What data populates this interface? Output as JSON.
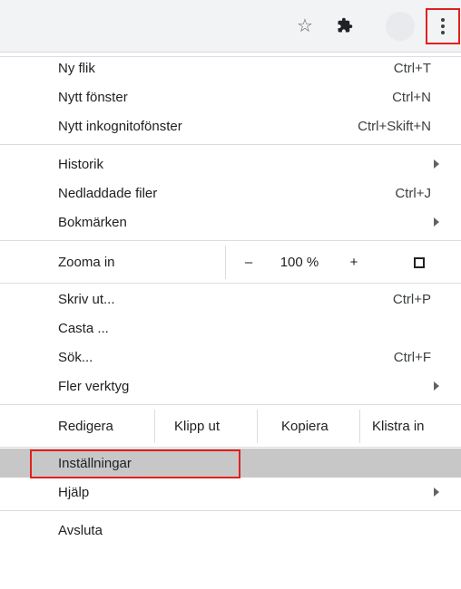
{
  "toolbar": {
    "star_icon": "star-icon",
    "extensions_icon": "puzzle-icon",
    "menu_icon": "three-dot-menu-icon",
    "highlight_color": "#e0211e"
  },
  "menu": {
    "group1": [
      {
        "label": "Ny flik",
        "shortcut": "Ctrl+T"
      },
      {
        "label": "Nytt fönster",
        "shortcut": "Ctrl+N"
      },
      {
        "label": "Nytt inkognitofönster",
        "shortcut": "Ctrl+Skift+N"
      }
    ],
    "group2": [
      {
        "label": "Historik"
      },
      {
        "label": "Nedladdade filer",
        "shortcut": "Ctrl+J"
      },
      {
        "label": "Bokmärken"
      }
    ],
    "zoom": {
      "label": "Zooma in",
      "minus": "–",
      "value": "100 %",
      "plus": "+"
    },
    "group3": [
      {
        "label": "Skriv ut...",
        "shortcut": "Ctrl+P"
      },
      {
        "label": "Casta ..."
      },
      {
        "label": "Sök...",
        "shortcut": "Ctrl+F"
      },
      {
        "label": "Fler verktyg"
      }
    ],
    "edit": {
      "label": "Redigera",
      "cut": "Klipp ut",
      "copy": "Kopiera",
      "paste": "Klistra in"
    },
    "group4": [
      {
        "label": "Inställningar"
      },
      {
        "label": "Hjälp"
      }
    ],
    "exit": {
      "label": "Avsluta"
    }
  }
}
